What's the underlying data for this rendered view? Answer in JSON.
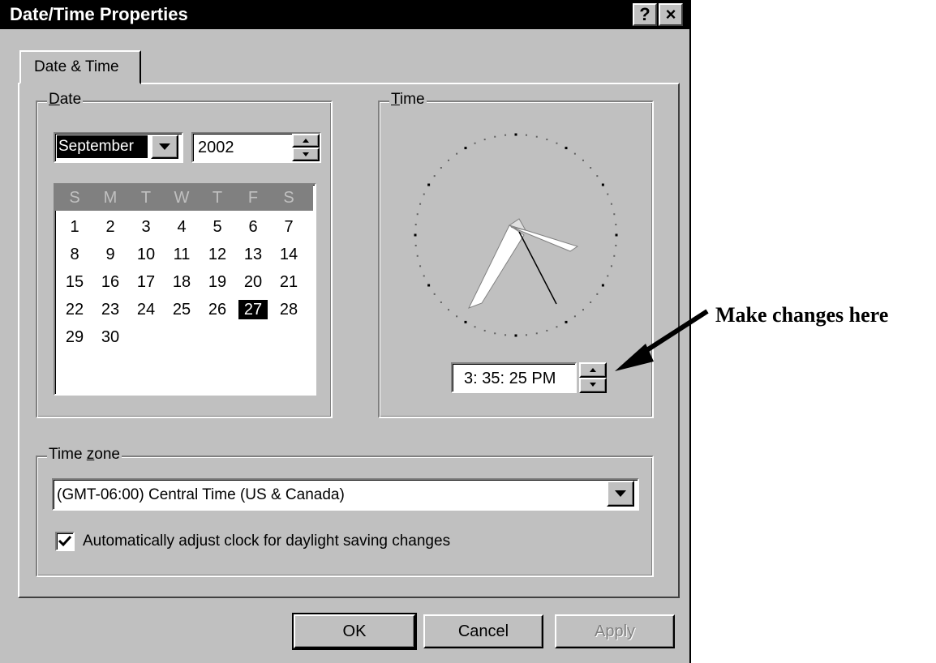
{
  "window": {
    "title": "Date/Time Properties",
    "help_button": "?",
    "close_button": "×"
  },
  "tabs": [
    {
      "label": "Date & Time"
    }
  ],
  "date_group": {
    "legend": "Date",
    "month": "September",
    "year": "2002",
    "weekday_headers": [
      "S",
      "M",
      "T",
      "W",
      "T",
      "F",
      "S"
    ],
    "weeks": [
      [
        "1",
        "2",
        "3",
        "4",
        "5",
        "6",
        "7"
      ],
      [
        "8",
        "9",
        "10",
        "11",
        "12",
        "13",
        "14"
      ],
      [
        "15",
        "16",
        "17",
        "18",
        "19",
        "20",
        "21"
      ],
      [
        "22",
        "23",
        "24",
        "25",
        "26",
        "27",
        "28"
      ],
      [
        "29",
        "30",
        "",
        "",
        "",
        "",
        ""
      ]
    ],
    "selected_day": "27"
  },
  "time_group": {
    "legend": "Time",
    "time_value": "3: 35: 25 PM"
  },
  "timezone_group": {
    "legend": "Time zone",
    "selected_zone": "(GMT-06:00) Central Time (US & Canada)",
    "dst_checkbox_label": "Automatically adjust clock for daylight saving changes",
    "dst_checked": true
  },
  "buttons": {
    "ok": "OK",
    "cancel": "Cancel",
    "apply": "Apply"
  },
  "annotation": {
    "text": "Make changes here"
  }
}
